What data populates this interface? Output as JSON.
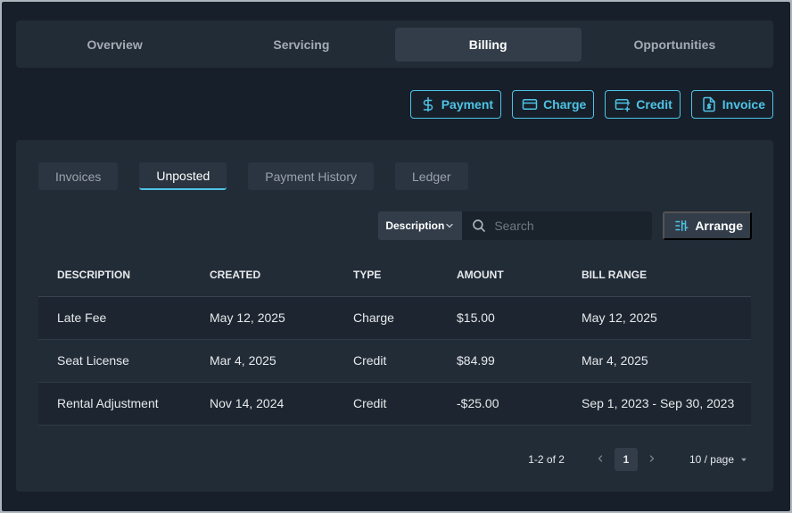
{
  "topnav": {
    "tabs": [
      {
        "label": "Overview"
      },
      {
        "label": "Servicing"
      },
      {
        "label": "Billing"
      },
      {
        "label": "Opportunities"
      }
    ],
    "active": "Billing"
  },
  "actions": {
    "payment": "Payment",
    "charge": "Charge",
    "credit": "Credit",
    "invoice": "Invoice"
  },
  "subtabs": {
    "items": [
      {
        "label": "Invoices"
      },
      {
        "label": "Unposted"
      },
      {
        "label": "Payment History"
      },
      {
        "label": "Ledger"
      }
    ],
    "active": "Unposted"
  },
  "toolbar": {
    "filter_field": "Description",
    "search_placeholder": "Search",
    "arrange_label": "Arrange"
  },
  "table": {
    "headers": [
      "DESCRIPTION",
      "CREATED",
      "TYPE",
      "AMOUNT",
      "BILL RANGE"
    ],
    "rows": [
      [
        "Late Fee",
        "May 12, 2025",
        "Charge",
        "$15.00",
        "May 12, 2025"
      ],
      [
        "Seat License",
        "Mar 4, 2025",
        "Credit",
        "$84.99",
        "Mar 4, 2025"
      ],
      [
        "Rental Adjustment",
        "Nov 14, 2024",
        "Credit",
        "-$25.00",
        "Sep 1, 2023 - Sep 30, 2023"
      ]
    ]
  },
  "pager": {
    "range": "1-2 of 2",
    "current_page": "1",
    "page_size": "10 / page"
  },
  "colors": {
    "accent": "#4fc3e6",
    "background": "#17202a",
    "panel": "#222c37"
  }
}
